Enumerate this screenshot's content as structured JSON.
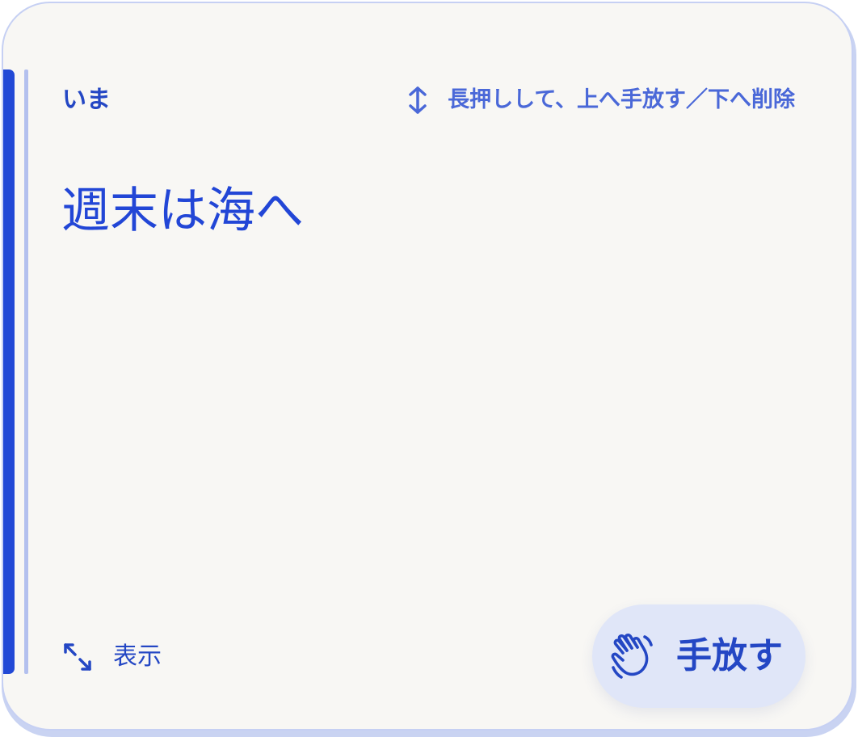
{
  "card": {
    "time_label": "いま",
    "hint_icon": "vertical-arrows-icon",
    "hint_text": "長押しして、上へ手放す／下へ削除",
    "title": "週末は海へ"
  },
  "actions": {
    "show_icon": "expand-diagonal-icon",
    "show_label": "表示",
    "release_icon": "waving-hand-icon",
    "release_label": "手放す"
  },
  "colors": {
    "accent": "#2249d6",
    "text": "#2447c4",
    "background": "#f8f7f4",
    "button_bg": "#e0e6f8"
  }
}
